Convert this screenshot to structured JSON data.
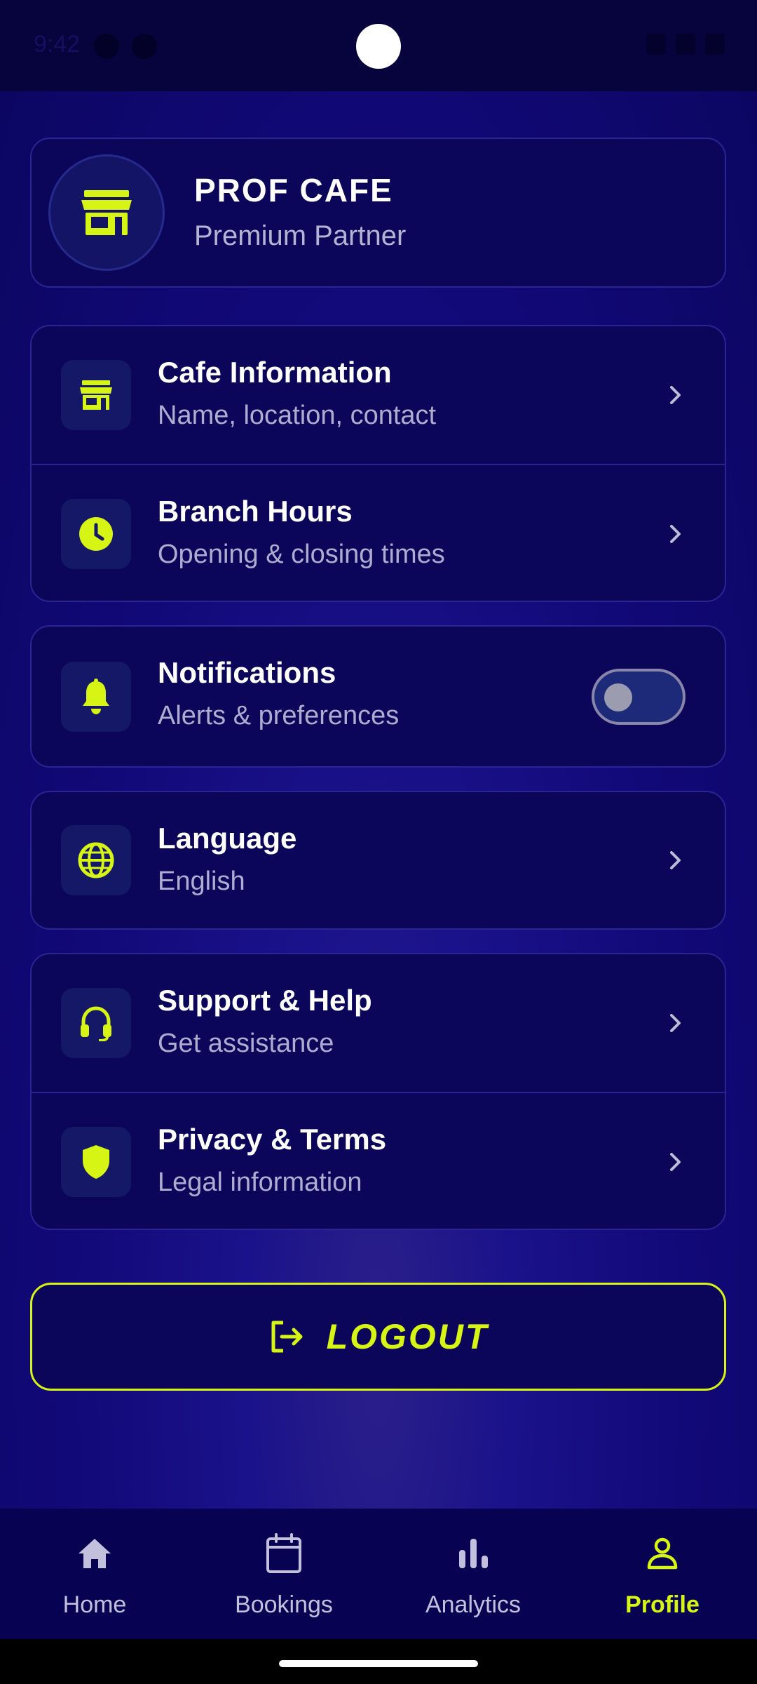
{
  "status_bar": {
    "time": "9:42"
  },
  "profile": {
    "name": "PROF CAFE",
    "subtitle": "Premium Partner"
  },
  "groups": {
    "cafe": [
      {
        "title": "Cafe Information",
        "subtitle": "Name, location, contact",
        "icon": "store-icon"
      },
      {
        "title": "Branch Hours",
        "subtitle": "Opening & closing times",
        "icon": "clock-icon"
      }
    ],
    "notifications": {
      "title": "Notifications",
      "subtitle": "Alerts & preferences",
      "icon": "bell-icon",
      "enabled": false
    },
    "language": {
      "title": "Language",
      "subtitle": "English",
      "icon": "globe-icon"
    },
    "support": [
      {
        "title": "Support & Help",
        "subtitle": "Get assistance",
        "icon": "headset-icon"
      },
      {
        "title": "Privacy & Terms",
        "subtitle": "Legal information",
        "icon": "shield-icon"
      }
    ]
  },
  "logout": {
    "label": "LOGOUT",
    "icon": "logout-icon"
  },
  "nav": {
    "items": [
      {
        "label": "Home",
        "icon": "home-icon",
        "active": false
      },
      {
        "label": "Bookings",
        "icon": "calendar-icon",
        "active": false
      },
      {
        "label": "Analytics",
        "icon": "bar-chart-icon",
        "active": false
      },
      {
        "label": "Profile",
        "icon": "user-icon",
        "active": true
      }
    ]
  },
  "colors": {
    "accent": "#d6f515",
    "background": "#0b0659",
    "border": "#2a2592",
    "muted_text": "#aeacd0"
  }
}
